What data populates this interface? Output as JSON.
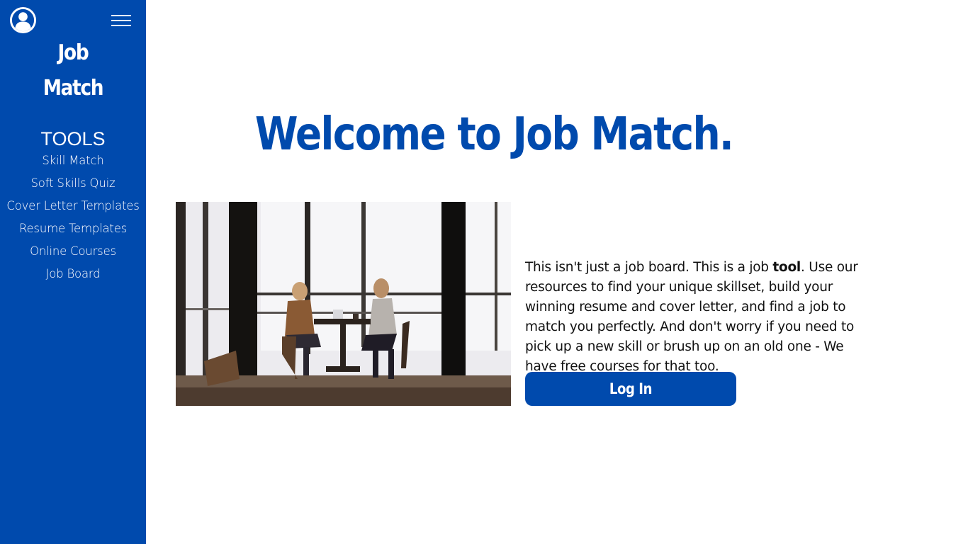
{
  "sidebar": {
    "brand_line1": "Job",
    "brand_line2": "Match",
    "tools_heading": "TOOLS",
    "items": [
      {
        "label": "Skill Match"
      },
      {
        "label": "Soft Skills Quiz"
      },
      {
        "label": "Cover Letter Templates"
      },
      {
        "label": "Resume Templates"
      },
      {
        "label": "Online Courses"
      },
      {
        "label": "Job Board"
      }
    ],
    "icons": {
      "avatar": "user-circle-icon",
      "menu": "hamburger-menu-icon"
    }
  },
  "main": {
    "headline": "Welcome to Job Match.",
    "intro_part1": "This isn't just a job board. This is a job ",
    "intro_emphasis": "tool",
    "intro_part2": ". Use our resources to find your unique skillset, build your winning resume and cover letter, and find a job to match you perfectly. And don't worry if you need to pick up a new skill or brush up on an old one - We have free courses for that too.",
    "login_label": "Log In"
  },
  "colors": {
    "brand": "#004aad",
    "background": "#ffffff",
    "text": "#111111"
  }
}
